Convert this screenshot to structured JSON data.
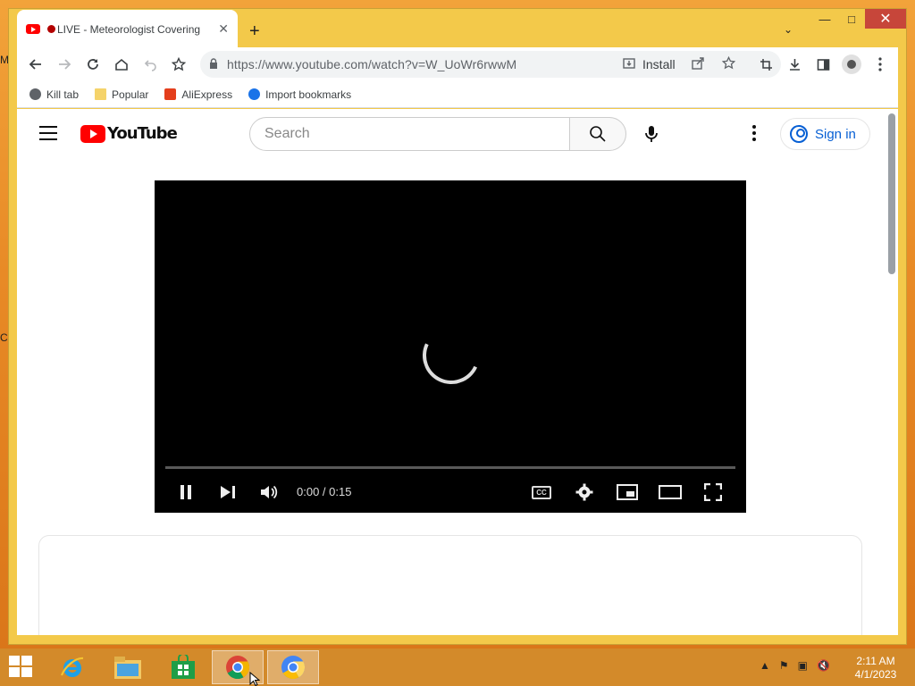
{
  "desktop": {
    "edge_letters": [
      "M",
      "C"
    ]
  },
  "window": {
    "minimize": "—",
    "maximize": "□",
    "close": "✕"
  },
  "tab": {
    "title": "LIVE - Meteorologist Covering",
    "close": "✕",
    "new_tab": "+",
    "tab_search": "⌄"
  },
  "toolbar": {
    "url": "https://www.youtube.com/watch?v=W_UoWr6rwwM",
    "install_label": "Install"
  },
  "bookmarks": [
    {
      "label": "Kill tab",
      "icon": "globe-icon"
    },
    {
      "label": "Popular",
      "icon": "folder-icon"
    },
    {
      "label": "AliExpress",
      "icon": "aliexpress-icon"
    },
    {
      "label": "Import bookmarks",
      "icon": "gear-icon"
    }
  ],
  "youtube": {
    "logo_text": "YouTube",
    "search_placeholder": "Search",
    "signin_label": "Sign in"
  },
  "player": {
    "time": "0:00 / 0:15",
    "cc_label": "CC",
    "progress": 0
  },
  "taskbar": {
    "apps": [
      "internet-explorer",
      "file-explorer",
      "store",
      "chrome",
      "chrome-canary"
    ],
    "clock_time": "2:11 AM",
    "clock_date": "4/1/2023"
  },
  "colors": {
    "youtube_red": "#ff0000",
    "link_blue": "#065fd4",
    "window_frame": "#f3c94a",
    "taskbar": "#d38a2a"
  }
}
